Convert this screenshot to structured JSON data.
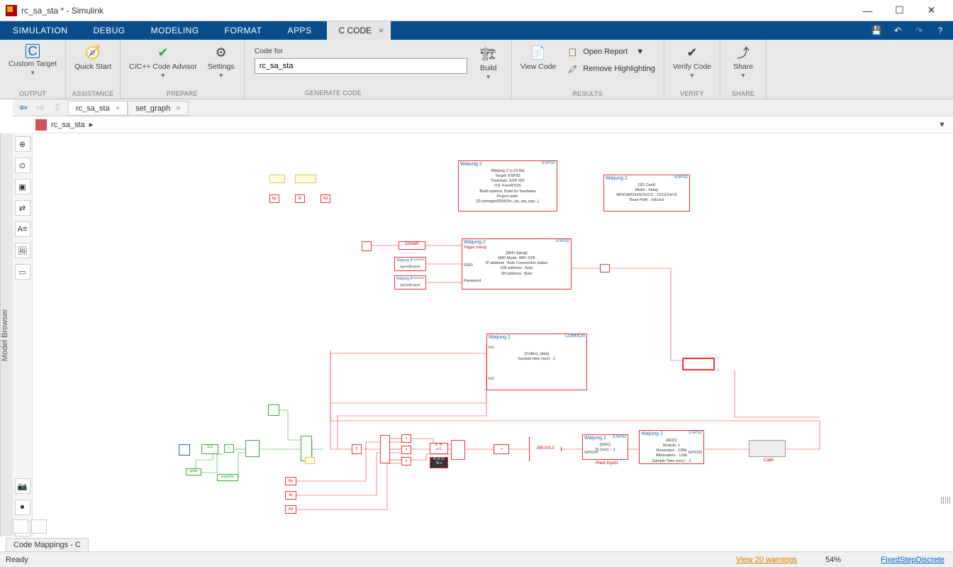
{
  "window": {
    "title": "rc_sa_sta * - Simulink"
  },
  "menu": {
    "tabs": [
      "SIMULATION",
      "DEBUG",
      "MODELING",
      "FORMAT",
      "APPS"
    ],
    "ccode": "C CODE"
  },
  "toolstrip": {
    "output": {
      "label": "OUTPUT",
      "btn": "Custom Target"
    },
    "assist": {
      "label": "ASSISTANCE",
      "btn": "Quick Start"
    },
    "prepare": {
      "label": "PREPARE",
      "advisor": "C/C++ Code Advisor",
      "settings": "Settings"
    },
    "generate": {
      "label": "GENERATE CODE",
      "code_for": "Code for",
      "code_for_value": "rc_sa_sta",
      "build": "Build"
    },
    "results": {
      "label": "RESULTS",
      "view": "View Code",
      "open_report": "Open Report",
      "remove_hl": "Remove Highlighting"
    },
    "verify": {
      "label": "VERIFY",
      "btn": "Verify Code"
    },
    "share": {
      "label": "SHARE",
      "btn": "Share"
    }
  },
  "filetabs": {
    "tab1": "rc_sa_sta",
    "tab2": "set_graph"
  },
  "pathbar": {
    "path": "rc_sa_sta",
    "sep": "▸"
  },
  "sidebar": {
    "label": "Model Browser"
  },
  "blocks": {
    "target": {
      "title": "Waijung 2",
      "tag": "ESP32",
      "body": "Waijung 2 (v.23.9a)\nTarget: ESP32\nToolchain: ESP-IDF\nOS: FreeRTOS\nBuild options: Build for hardware\nProject path:\n[D:/aimagin/23360/rc_sa_sta_esp...]"
    },
    "sdcard": {
      "title": "Waijung 2",
      "tag": "ESP32",
      "body": "[SD Card]\nMode : Setup\nMISO/MOSI/SCK/CS : 12/13/14/15\nBase Path : /sdcard"
    },
    "convert": {
      "label": "convert"
    },
    "sprintf1": {
      "title": "Waijung 2",
      "tag": "COMMON",
      "body": "[sprintf]Output"
    },
    "sprintf2": {
      "title": "Waijung 2",
      "tag": "COMMON",
      "body": "[sprintf]Output"
    },
    "wifi": {
      "title": "Waijung 2",
      "tag": "ESP32",
      "trig": "Trigger (rising)",
      "body": "[WiFi Setup]\nWiFi Mode: WiFi STA\nIP address      : Auto   Connection status\nGW address   : Auto\nSN address    : Auto",
      "p1": "SSID",
      "p2": "Password"
    },
    "collect": {
      "title": "Waijung 2",
      "tag": "COMMON",
      "body": "[Collect_data]\nSample time (sec): -1",
      "p1": "In1",
      "p2": "In2"
    },
    "dac": {
      "title": "Waijung 2",
      "tag": "ESP32",
      "body": "[DAC]\nTs (sec) : -1",
      "port": "GPIO25",
      "sub": "Plant Input1"
    },
    "adc": {
      "title": "Waijung 2",
      "tag": "ESP32",
      "body": "[ADC]\nModule: 1\nResolution : 12Bit\nAttenuation : 11db\nSample Time (sec) : -1",
      "port": "GPIO33"
    },
    "calib": {
      "label": "Calib"
    },
    "gain": {
      "label": "255.0/3.3"
    },
    "kts": {
      "label": "K Ts\nz-1"
    },
    "kz1": {
      "label": "K (z-1)\nTs z"
    },
    "ampl": "ampl",
    "baseline": "baseline",
    "kp": "Kp",
    "ki": "Ki",
    "kd": "Kd",
    "oneZ": "1/Z"
  },
  "mappings": {
    "tab": "Code Mappings - C"
  },
  "status": {
    "ready": "Ready",
    "warnings": "View 20 warnings",
    "zoom": "54%",
    "solver": "FixedStepDiscrete"
  }
}
